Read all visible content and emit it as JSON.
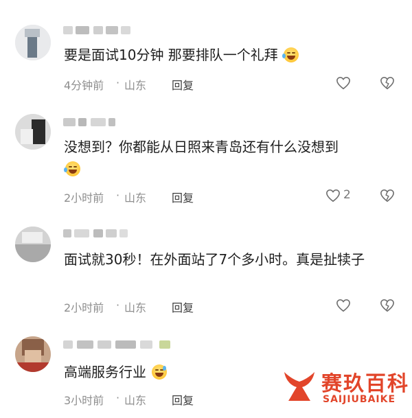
{
  "comments": [
    {
      "text": "要是面试10分钟 那要排队一个礼拜",
      "emoji": "rofl-emoji",
      "time": "4分钟前",
      "location": "山东",
      "reply_label": "回复",
      "likes": ""
    },
    {
      "text": "没想到？你都能从日照来青岛还有什么没想到",
      "emoji": "rofl-emoji",
      "time": "2小时前",
      "location": "山东",
      "reply_label": "回复",
      "likes": "2"
    },
    {
      "text": "面试就30秒！在外面站了7个多小时。真是扯犊子",
      "emoji": "",
      "time": "2小时前",
      "location": "山东",
      "reply_label": "回复",
      "likes": ""
    },
    {
      "text": "高端服务行业",
      "emoji": "sweat-smile-emoji",
      "time": "3小时前",
      "location": "山东",
      "reply_label": "回复",
      "likes": ""
    }
  ],
  "meta_separator": "·",
  "watermark": {
    "title": "赛玖百科",
    "subtitle": "SAIJIUBAIKE",
    "color": "#e2452a"
  },
  "colors": {
    "text": "#1e1e1e",
    "meta": "#8e8e8e",
    "icon": "#6e6e6e"
  }
}
